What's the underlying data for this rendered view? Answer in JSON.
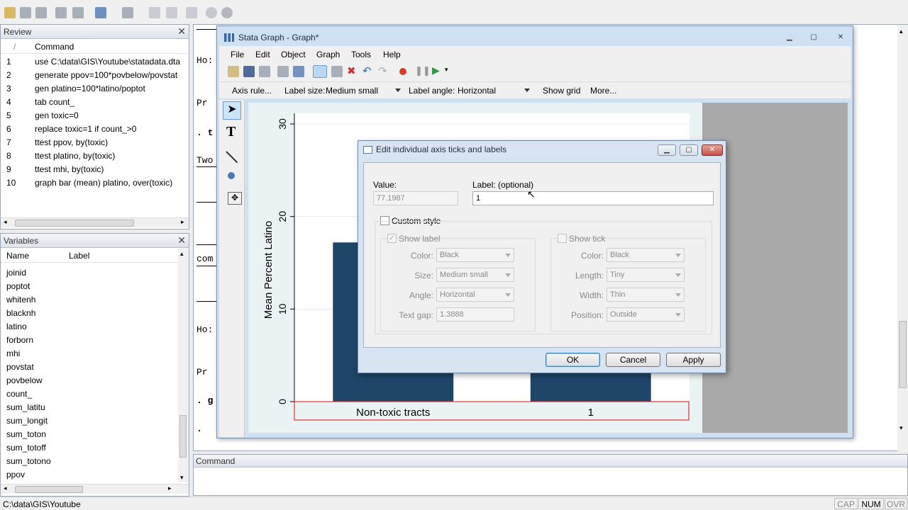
{
  "review": {
    "title": "Review",
    "col_command": "Command",
    "rows": [
      {
        "n": "1",
        "cmd": "use C:\\data\\GIS\\Youtube\\statadata.dta"
      },
      {
        "n": "2",
        "cmd": "generate ppov=100*povbelow/povstat"
      },
      {
        "n": "3",
        "cmd": "gen platino=100*latino/poptot"
      },
      {
        "n": "4",
        "cmd": "tab count_"
      },
      {
        "n": "5",
        "cmd": "gen toxic=0"
      },
      {
        "n": "6",
        "cmd": "replace toxic=1 if count_>0"
      },
      {
        "n": "7",
        "cmd": "ttest ppov, by(toxic)"
      },
      {
        "n": "8",
        "cmd": "ttest platino, by(toxic)"
      },
      {
        "n": "9",
        "cmd": "ttest mhi, by(toxic)"
      },
      {
        "n": "10",
        "cmd": "graph bar (mean) platino, over(toxic)"
      }
    ]
  },
  "variables": {
    "title": "Variables",
    "col_name": "Name",
    "col_label": "Label",
    "items": [
      "joinid",
      "poptot",
      "whitenh",
      "blacknh",
      "latino",
      "forborn",
      "mhi",
      "povstat",
      "povbelow",
      "count_",
      "sum_latitu",
      "sum_longit",
      "sum_toton",
      "sum_totoff",
      "sum_totono",
      "ppov"
    ]
  },
  "results_fragments": [
    "Ho:",
    "Pr",
    ". t",
    "Two",
    "(",
    "com",
    "Ho:",
    "Pr",
    ". g",
    "."
  ],
  "command_panel": {
    "title": "Command"
  },
  "status_bar": {
    "path": "C:\\data\\GIS\\Youtube",
    "caps": "CAP",
    "num": "NUM",
    "ovr": "OVR"
  },
  "graph_window": {
    "title": "Stata Graph - Graph*",
    "menu": [
      "File",
      "Edit",
      "Object",
      "Graph",
      "Tools",
      "Help"
    ],
    "contextbar": {
      "axis_rule": "Axis rule...",
      "label_size_label": "Label size:",
      "label_size_value": "Medium small",
      "label_angle_label": "Label angle:",
      "label_angle_value": "Horizontal",
      "show_grid": "Show grid",
      "more": "More..."
    }
  },
  "chart_data": {
    "type": "bar",
    "categories": [
      "Non-toxic tracts",
      "1"
    ],
    "values": [
      17.2,
      17.2
    ],
    "ylabel": "Mean Percent Latino",
    "yticks": [
      "0",
      "10",
      "20",
      "30"
    ],
    "ylim": [
      0,
      30
    ],
    "bar_color": "#1f4568",
    "grid": true
  },
  "dialog": {
    "title": "Edit individual axis ticks and labels",
    "value_label": "Value:",
    "value": "77.1987",
    "label_label": "Label: (optional)",
    "label_value": "1",
    "custom_style": "Custom style",
    "show_label": "Show label",
    "show_tick": "Show tick",
    "left": {
      "color_label": "Color:",
      "color": "Black",
      "size_label": "Size:",
      "size": "Medium small",
      "angle_label": "Angle:",
      "angle": "Horizontal",
      "gap_label": "Text gap:",
      "gap": "1.3888"
    },
    "right": {
      "color_label": "Color:",
      "color": "Black",
      "length_label": "Length:",
      "length": "Tiny",
      "width_label": "Width:",
      "width": "Thin",
      "position_label": "Position:",
      "position": "Outside"
    },
    "ok": "OK",
    "cancel": "Cancel",
    "apply": "Apply"
  }
}
